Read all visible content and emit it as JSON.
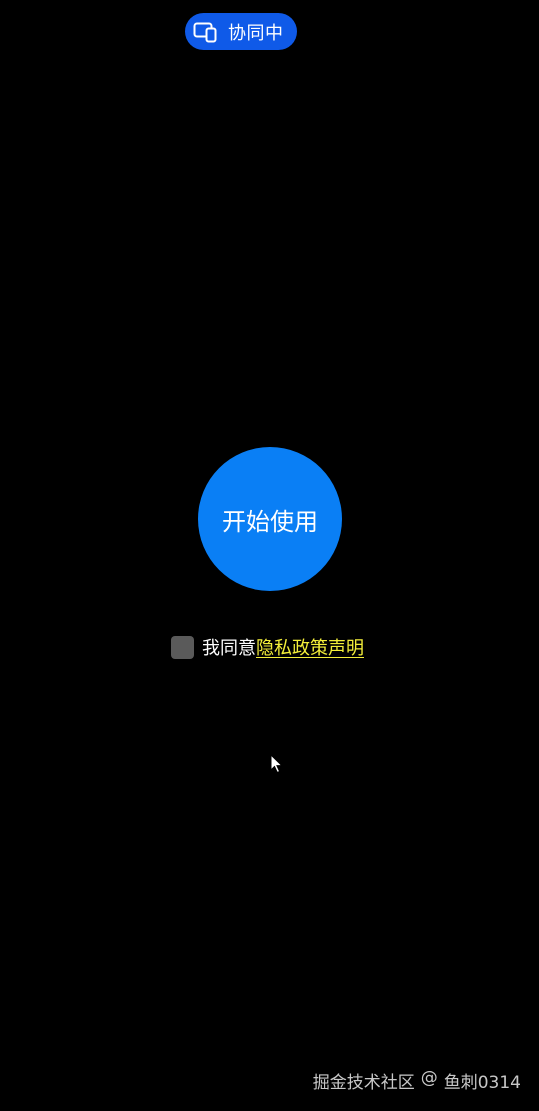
{
  "header": {
    "collab_label": "协同中",
    "collab_icon": "devices-icon",
    "accent_color": "#0f5ae8"
  },
  "main": {
    "start_button_label": "开始使用",
    "start_button_color": "#0a7ff5"
  },
  "consent": {
    "checked": false,
    "prefix_text": "我同意",
    "link_text": "隐私政策声明",
    "link_color": "#f4ef3a"
  },
  "watermark": {
    "site": "掘金技术社区",
    "at": "@",
    "author": "鱼刺0314"
  }
}
